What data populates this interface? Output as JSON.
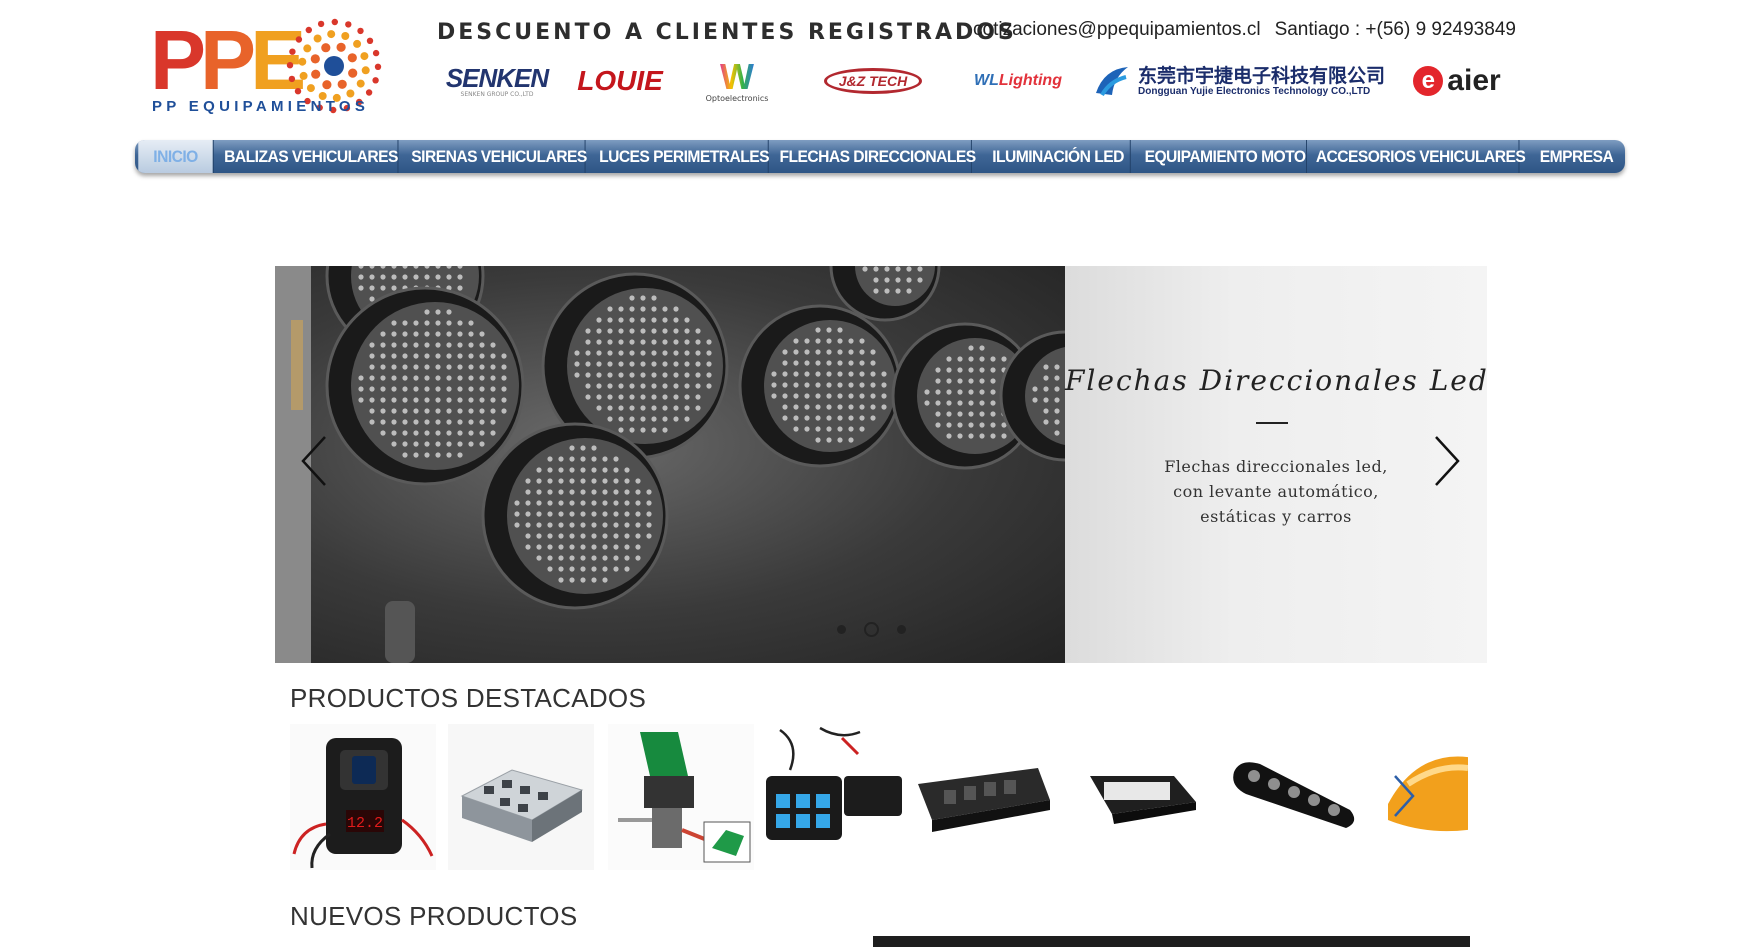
{
  "brand": {
    "logo_text": "PPE",
    "tagline": "PP EQUIPAMIENTOS"
  },
  "header": {
    "promo": "DESCUENTO A CLIENTES REGISTRADOS",
    "email": "cotizaciones@ppequipamientos.cl",
    "phone": "Santiago : +(56) 9 92493849"
  },
  "partners": {
    "senken": "SENKEN",
    "senken_sub": "SENKEN GROUP CO.,LTD",
    "louie": "LOUIE",
    "w_mark": "W",
    "w_sub": "Optoelectronics",
    "jz": "J&Z TECH",
    "wl": "WL",
    "wl_light": "Lighting",
    "yujie_cn": "东莞市宇捷电子科技有限公司",
    "yujie_en": "Dongguan Yujie Electronics Technology CO.,LTD",
    "aier_e": "e",
    "aier": "aier"
  },
  "nav": {
    "items": [
      {
        "label": "INICIO"
      },
      {
        "label": "BALIZAS VEHICULARES"
      },
      {
        "label": "SIRENAS VEHICULARES"
      },
      {
        "label": "LUCES PERIMETRALES"
      },
      {
        "label": "FLECHAS DIRECCIONALES"
      },
      {
        "label": "ILUMINACIÓN LED"
      },
      {
        "label": "EQUIPAMIENTO MOTO"
      },
      {
        "label": "ACCESORIOS VEHICULARES"
      },
      {
        "label": "EMPRESA"
      }
    ],
    "active_index": 0
  },
  "slider": {
    "title": "Flechas Direccionales Led",
    "text_line1": "Flechas direccionales led,",
    "text_line2": "con levante automático,",
    "text_line3": "estáticas y carros",
    "slide_count": 3,
    "current_slide": 2
  },
  "sections": {
    "featured": "PRODUCTOS DESTACADOS",
    "new": "NUEVOS PRODUCTOS"
  },
  "products": [
    {
      "name": "battery-monitor-switch-panel"
    },
    {
      "name": "fuse-block"
    },
    {
      "name": "toggle-switch-green-cover"
    },
    {
      "name": "switch-panel-controller"
    },
    {
      "name": "switch-row-mount"
    },
    {
      "name": "led-strobe-light"
    },
    {
      "name": "led-light-bar"
    },
    {
      "name": "amber-beacon"
    }
  ],
  "colors": {
    "nav_top": "#7f9dc1",
    "nav_bottom": "#2e5585",
    "nav_active_text": "#7fb0e6",
    "logo_red": "#d9372b",
    "logo_orange": "#f0a020",
    "logo_blue": "#1f4f99",
    "arrow_blue": "#2d5fa8"
  }
}
